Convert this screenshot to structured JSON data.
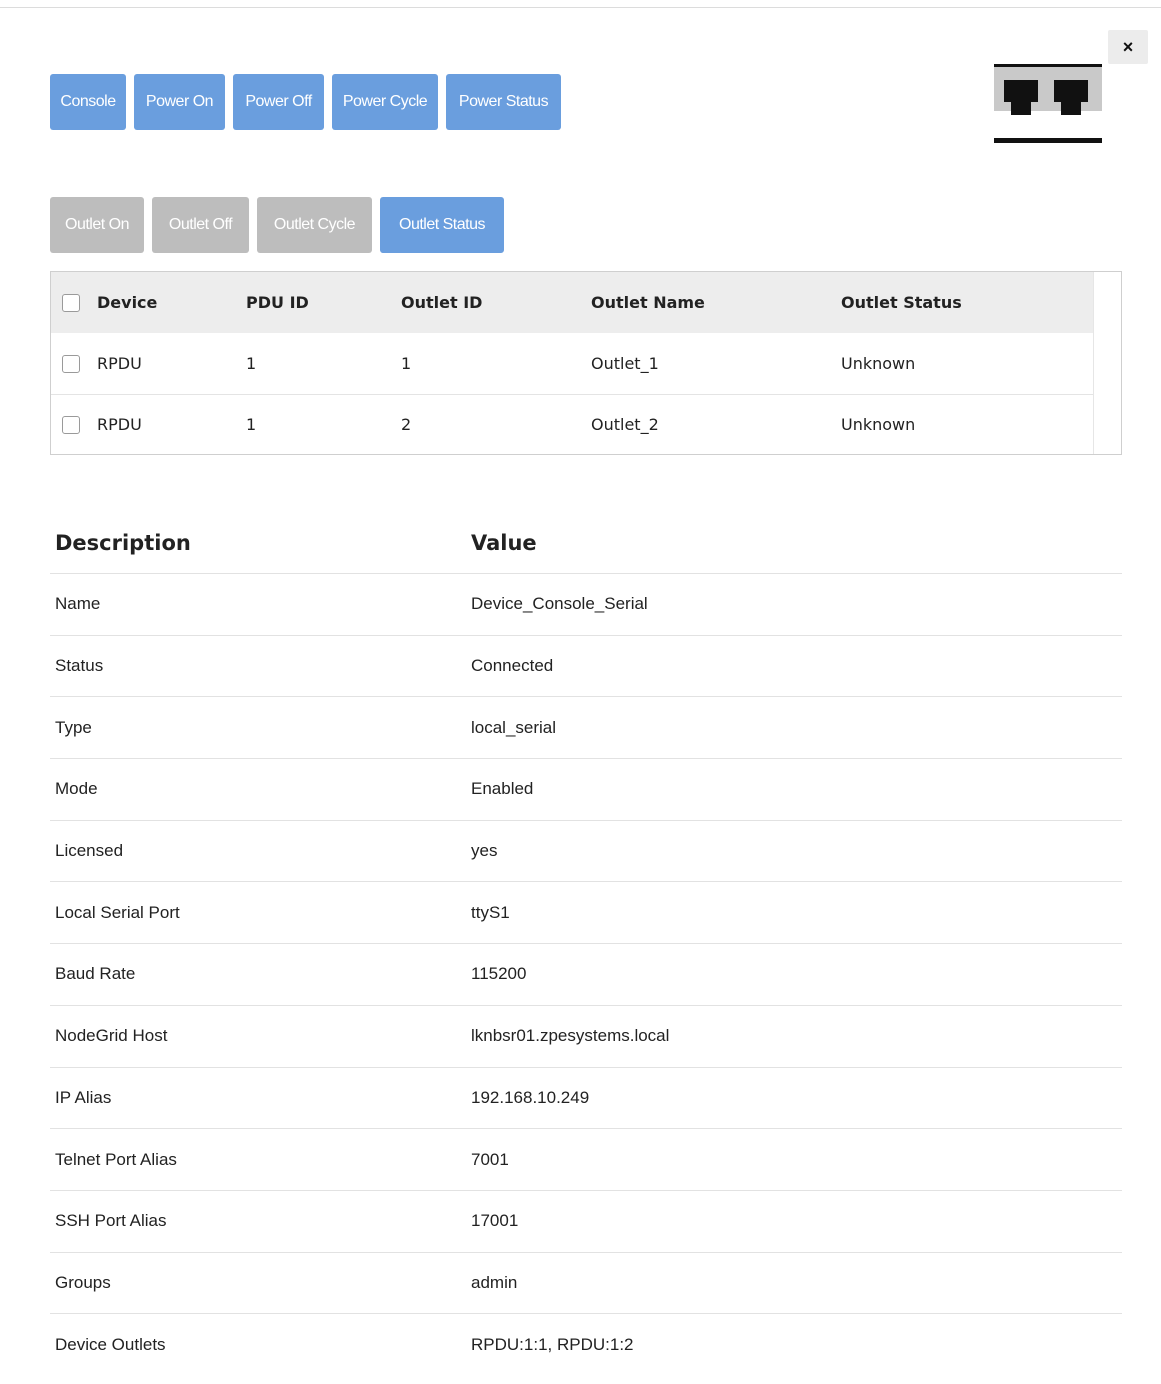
{
  "close": {
    "label": "×"
  },
  "device_icon": {
    "name": "ethernet-ports-icon"
  },
  "power_buttons": [
    {
      "label": "Console"
    },
    {
      "label": "Power On"
    },
    {
      "label": "Power Off"
    },
    {
      "label": "Power Cycle"
    },
    {
      "label": "Power Status"
    }
  ],
  "outlet_buttons": [
    {
      "label": "Outlet On",
      "state": "disabled"
    },
    {
      "label": "Outlet Off",
      "state": "disabled"
    },
    {
      "label": "Outlet Cycle",
      "state": "disabled"
    },
    {
      "label": "Outlet Status",
      "state": "enabled"
    }
  ],
  "outlets": {
    "headers": [
      "Device",
      "PDU ID",
      "Outlet ID",
      "Outlet Name",
      "Outlet Status"
    ],
    "rows": [
      {
        "device": "RPDU",
        "pdu_id": "1",
        "outlet_id": "1",
        "name": "Outlet_1",
        "status": "Unknown"
      },
      {
        "device": "RPDU",
        "pdu_id": "1",
        "outlet_id": "2",
        "name": "Outlet_2",
        "status": "Unknown"
      }
    ]
  },
  "details": {
    "headers": {
      "description": "Description",
      "value": "Value"
    },
    "rows": [
      {
        "k": "Name",
        "v": "Device_Console_Serial"
      },
      {
        "k": "Status",
        "v": "Connected"
      },
      {
        "k": "Type",
        "v": "local_serial"
      },
      {
        "k": "Mode",
        "v": "Enabled"
      },
      {
        "k": "Licensed",
        "v": "yes"
      },
      {
        "k": "Local Serial Port",
        "v": "ttyS1"
      },
      {
        "k": "Baud Rate",
        "v": "115200"
      },
      {
        "k": "NodeGrid Host",
        "v": "lknbsr01.zpesystems.local"
      },
      {
        "k": "IP Alias",
        "v": "192.168.10.249"
      },
      {
        "k": "Telnet Port Alias",
        "v": "7001"
      },
      {
        "k": "SSH Port Alias",
        "v": "17001"
      },
      {
        "k": "Groups",
        "v": "admin"
      },
      {
        "k": "Device Outlets",
        "v": "RPDU:1:1, RPDU:1:2"
      }
    ]
  },
  "colors": {
    "primary_button": "#6a9ede",
    "disabled_button": "#bdbdbd",
    "table_header_bg": "#ededed"
  }
}
